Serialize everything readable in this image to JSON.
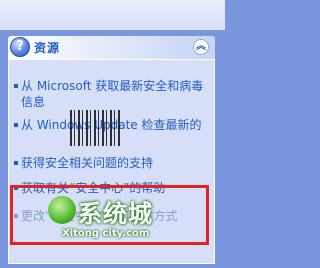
{
  "panel": {
    "title": "资源",
    "collapse_icon": "chevron-double-up-icon",
    "items": [
      {
        "label": "从 Microsoft 获取最新安全和病毒信息"
      },
      {
        "label": "从 Windows Update 检查最新的"
      },
      {
        "label": "获得安全相关问题的支持"
      },
      {
        "label": "获取有关“安全中心”的帮助"
      },
      {
        "label": "更改“安全中心”通知我的方式"
      }
    ]
  },
  "watermark": {
    "brand": "系统城",
    "url": "Xitong city.com"
  },
  "colors": {
    "link": "#215dc6",
    "panel_body": "#d6dff7",
    "window_bg": "#7a96df",
    "highlight": "#e52222"
  }
}
